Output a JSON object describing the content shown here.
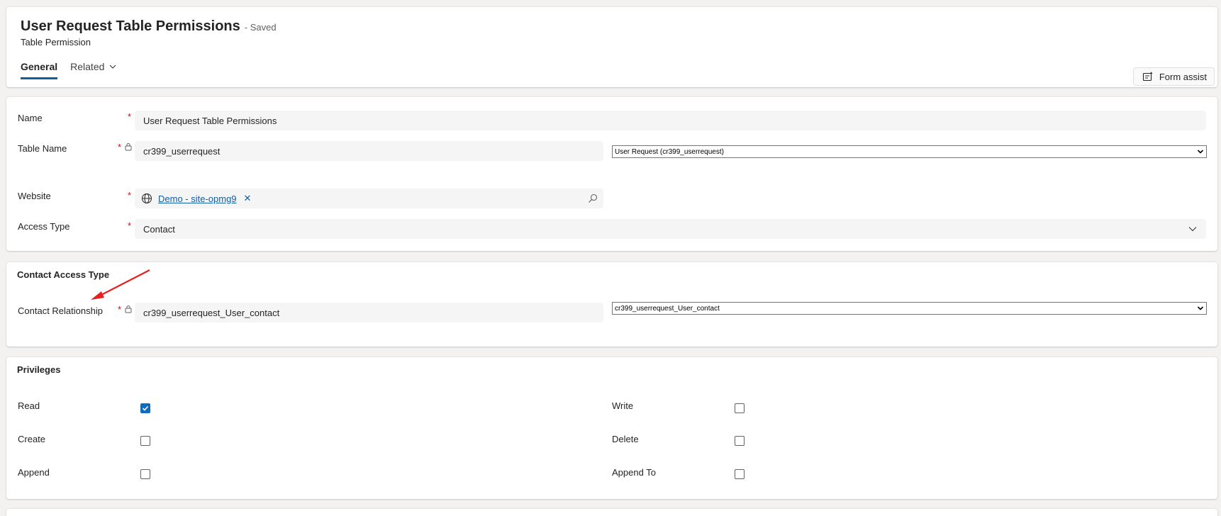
{
  "header": {
    "title": "User Request Table Permissions",
    "saved_status": "- Saved",
    "entity_name": "Table Permission",
    "tabs": [
      {
        "label": "General",
        "active": true
      },
      {
        "label": "Related",
        "active": false
      }
    ],
    "form_assist_label": "Form assist"
  },
  "general": {
    "name_label": "Name",
    "name_value": "User Request Table Permissions",
    "table_name_label": "Table Name",
    "table_name_value": "cr399_userrequest",
    "table_select_value": "User Request (cr399_userrequest)",
    "website_label": "Website",
    "website_value": "Demo - site-opmg9",
    "access_type_label": "Access Type",
    "access_type_value": "Contact"
  },
  "contact_access": {
    "section_title": "Contact Access Type",
    "relationship_label": "Contact Relationship",
    "relationship_value": "cr399_userrequest_User_contact",
    "relationship_select_value": "cr399_userrequest_User_contact"
  },
  "privileges": {
    "section_title": "Privileges",
    "items": [
      {
        "label": "Read",
        "checked": true
      },
      {
        "label": "Write",
        "checked": false
      },
      {
        "label": "Create",
        "checked": false
      },
      {
        "label": "Delete",
        "checked": false
      },
      {
        "label": "Append",
        "checked": false
      },
      {
        "label": "Append To",
        "checked": false
      }
    ]
  },
  "required_marker": "*",
  "colors": {
    "accent": "#115ea3",
    "required": "#c50f1f",
    "annotation_arrow": "#e8201e"
  }
}
